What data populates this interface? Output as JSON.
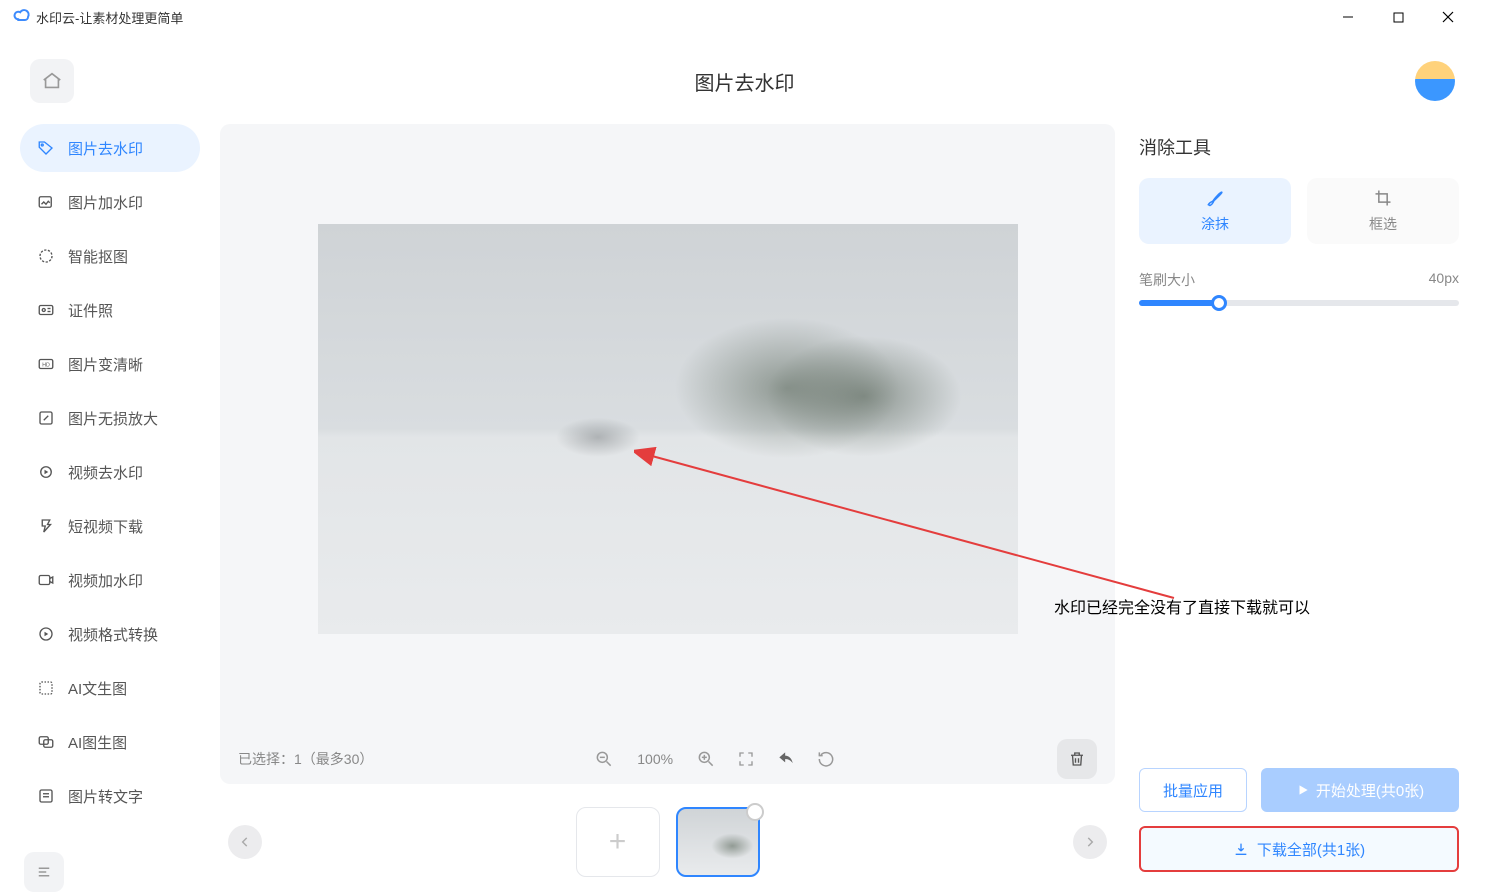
{
  "app": {
    "title": "水印云-让素材处理更简单"
  },
  "header": {
    "page_title": "图片去水印"
  },
  "sidebar": {
    "items": [
      {
        "label": "图片去水印",
        "active": true
      },
      {
        "label": "图片加水印"
      },
      {
        "label": "智能抠图"
      },
      {
        "label": "证件照"
      },
      {
        "label": "图片变清晰"
      },
      {
        "label": "图片无损放大"
      },
      {
        "label": "视频去水印"
      },
      {
        "label": "短视频下载"
      },
      {
        "label": "视频加水印"
      },
      {
        "label": "视频格式转换"
      },
      {
        "label": "AI文生图"
      },
      {
        "label": "AI图生图"
      },
      {
        "label": "图片转文字"
      }
    ]
  },
  "canvas": {
    "select_info": "已选择：1（最多30）",
    "zoom_pct": "100%"
  },
  "right_panel": {
    "heading": "消除工具",
    "tab_brush": "涂抹",
    "tab_rect": "框选",
    "brush_label": "笔刷大小",
    "brush_value": "40px",
    "batch_label": "批量应用",
    "start_label": "开始处理(共0张)",
    "download_label": "下载全部(共1张)"
  },
  "annotation": {
    "text": "水印已经完全没有了直接下载就可以"
  }
}
